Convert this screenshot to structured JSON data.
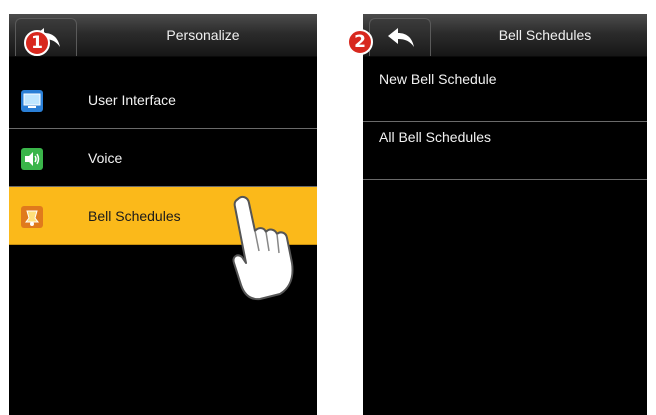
{
  "step1": {
    "badge": "1",
    "title": "Personalize",
    "items": [
      {
        "label": "User Interface",
        "icon": "monitor-icon",
        "selected": false
      },
      {
        "label": "Voice",
        "icon": "speaker-icon",
        "selected": false
      },
      {
        "label": "Bell Schedules",
        "icon": "bell-icon",
        "selected": true
      }
    ]
  },
  "step2": {
    "badge": "2",
    "title": "Bell Schedules",
    "items": [
      {
        "label": "New Bell Schedule"
      },
      {
        "label": "All Bell Schedules"
      }
    ]
  },
  "colors": {
    "highlight": "#fbb91a",
    "badge": "#d8281e",
    "screen": "#000000"
  }
}
